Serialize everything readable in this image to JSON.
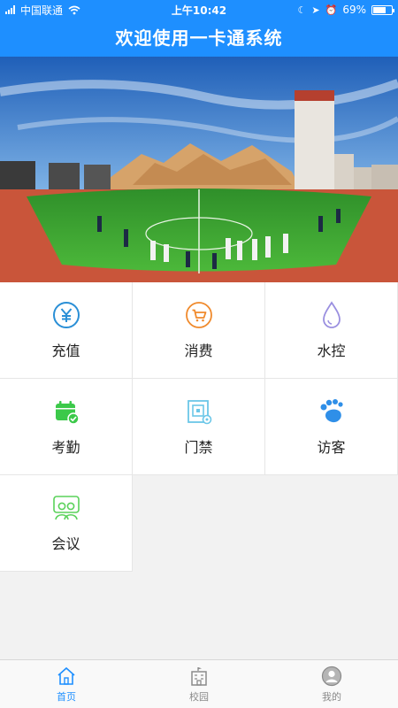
{
  "status_bar": {
    "carrier": "中国联通",
    "time": "上午10:42",
    "battery": "69%",
    "battery_level": 0.69
  },
  "header": {
    "title": "欢迎使用一卡通系统"
  },
  "banner": {
    "alt": "campus sports field banner"
  },
  "grid": {
    "items": [
      {
        "label": "充值",
        "icon": "yuan-coin-icon"
      },
      {
        "label": "消费",
        "icon": "shopping-cart-icon"
      },
      {
        "label": "水控",
        "icon": "water-drop-icon"
      },
      {
        "label": "考勤",
        "icon": "calendar-check-icon"
      },
      {
        "label": "门禁",
        "icon": "door-access-icon"
      },
      {
        "label": "访客",
        "icon": "footprint-icon"
      },
      {
        "label": "会议",
        "icon": "meeting-people-icon"
      }
    ]
  },
  "tabbar": {
    "items": [
      {
        "label": "首页",
        "icon": "home-icon",
        "active": true
      },
      {
        "label": "校园",
        "icon": "campus-building-icon",
        "active": false
      },
      {
        "label": "我的",
        "icon": "user-profile-icon",
        "active": false
      }
    ]
  },
  "colors": {
    "header_blue": "#1e8fff",
    "charge_blue": "#2a8fd6",
    "consume_orange": "#f08a2c",
    "water_purple": "#9a8fe0",
    "attendance_green": "#3cc94a",
    "door_cyan": "#6cc7e8",
    "visitor_blue": "#2f8fe8",
    "meeting_green": "#5ad25a"
  }
}
